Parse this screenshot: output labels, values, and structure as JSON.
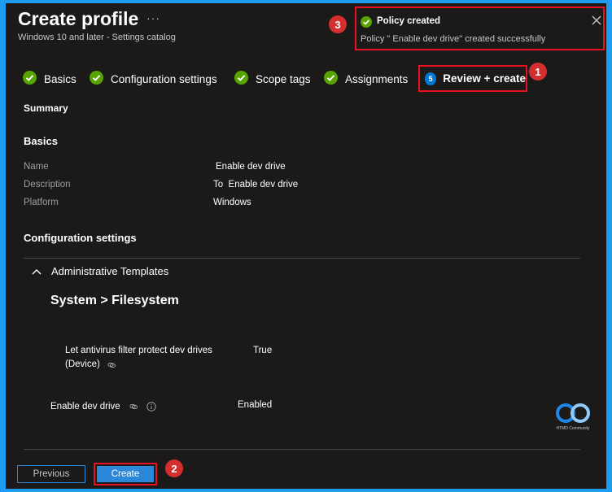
{
  "header": {
    "title": "Create profile",
    "ellipsis": "···",
    "subtitle": "Windows 10 and later - Settings catalog"
  },
  "toast": {
    "title": "Policy created",
    "message": "Policy \" Enable dev drive\" created successfully"
  },
  "badges": {
    "one": "1",
    "two": "2",
    "three": "3"
  },
  "steps": [
    {
      "label": "Basics",
      "status": "completed"
    },
    {
      "label": "Configuration settings",
      "status": "completed"
    },
    {
      "label": "Scope tags",
      "status": "completed"
    },
    {
      "label": "Assignments",
      "status": "completed"
    },
    {
      "label": "Review + create",
      "status": "active",
      "number": "5"
    }
  ],
  "summary": {
    "heading": "Summary",
    "basics_heading": "Basics",
    "fields": [
      {
        "label": "Name",
        "value": "Enable dev drive"
      },
      {
        "label": "Description",
        "value": "To  Enable dev drive"
      },
      {
        "label": "Platform",
        "value": "Windows"
      }
    ],
    "config_heading": "Configuration settings",
    "group_label": "Administrative Templates",
    "category_path": "System > Filesystem",
    "settings": [
      {
        "name_line1": "Let antivirus filter protect dev drives",
        "name_line2": "(Device)",
        "value": "True"
      },
      {
        "name_line1": "Enable dev drive",
        "value": "Enabled"
      }
    ]
  },
  "footer": {
    "previous_label": "Previous",
    "create_label": "Create"
  },
  "logo_text": "HTMD Community",
  "colors": {
    "background": "#1b1a19",
    "border_frame": "#1d9bf0",
    "accent": "#2b88d8",
    "success": "#57a300",
    "highlight": "#e81123",
    "badge": "#d32f2f"
  }
}
